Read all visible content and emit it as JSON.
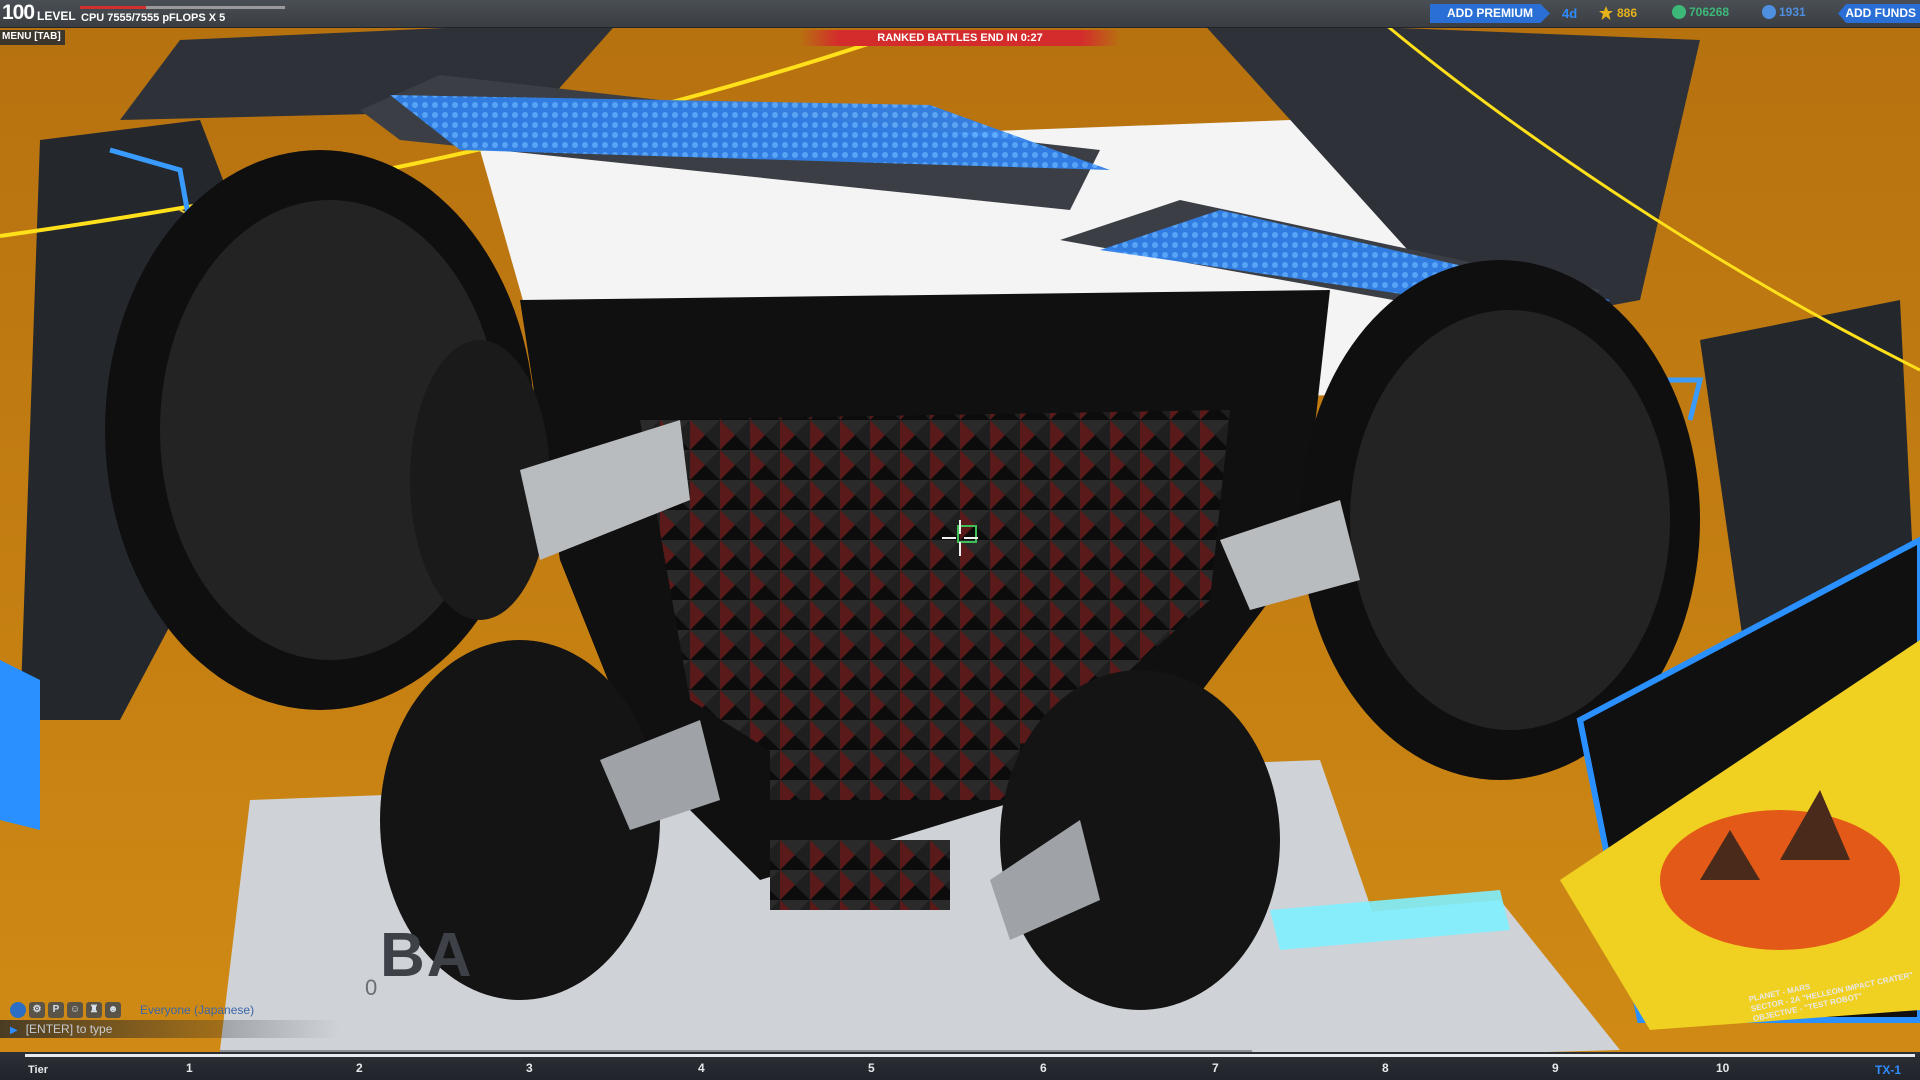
{
  "hud": {
    "level_number": "100",
    "level_label": "LEVEL",
    "cpu_text": "CPU 7555/7555 pFLOPS X 5",
    "cpu_fill_fraction": 1.0,
    "menu_label": "MENU [TAB]",
    "ranked_banner": "RANKED BATTLES END IN 0:27",
    "add_premium": "ADD PREMIUM",
    "premium_days": "4d",
    "tech_points": "886",
    "robits": "706268",
    "cosmetic_credits": "1931",
    "add_funds": "ADD FUNDS"
  },
  "chat": {
    "channel": "Everyone (Japanese)",
    "input_placeholder": "[ENTER] to type",
    "icons": [
      "globe-icon",
      "gear-icon",
      "party-icon",
      "friend-icon",
      "clan-icon",
      "user-icon"
    ],
    "icon_glyphs": [
      "",
      "",
      "P",
      "",
      "",
      ""
    ]
  },
  "tier_bar": {
    "label": "Tier",
    "marks": [
      "1",
      "2",
      "3",
      "4",
      "5",
      "6",
      "7",
      "8",
      "9",
      "10"
    ],
    "current": "TX-1"
  },
  "scene": {
    "floor_text": "BA",
    "floor_number": "0",
    "planet_card": {
      "planet": "PLANET - MARS",
      "sector": "SECTOR - 2A \"HELLEON IMPACT CRATER\"",
      "objective": "OBJECTIVE - \"TEST ROBOT\""
    }
  },
  "colors": {
    "accent_blue": "#2a6fd6",
    "ranked_red": "#d42c2c",
    "tech_gold": "#e6b21a",
    "robits_green": "#3cb878",
    "cc_blue": "#4f8fe0",
    "background_orange": "#c98413"
  }
}
